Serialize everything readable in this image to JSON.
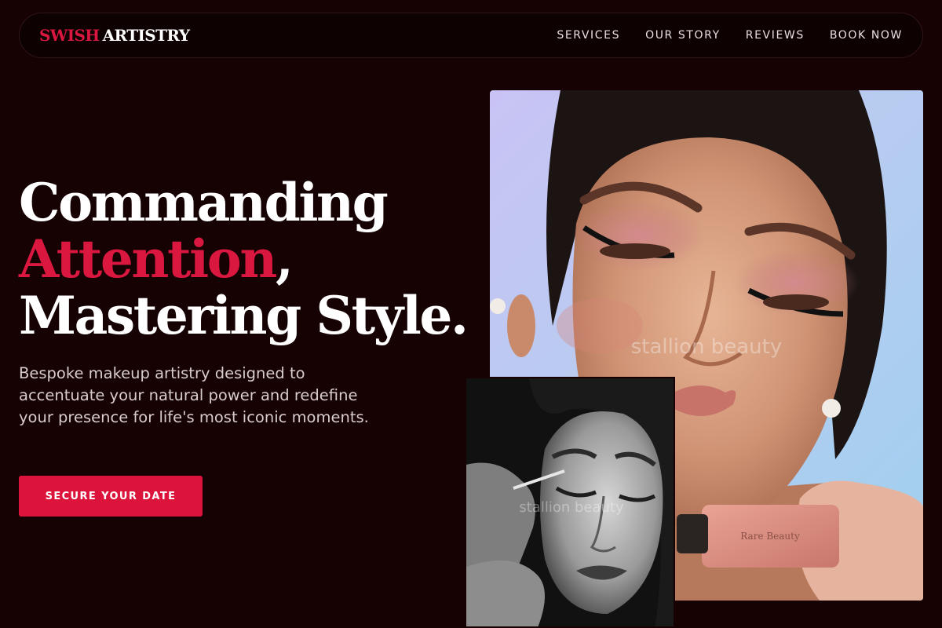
{
  "brand": {
    "part1": "SWISH",
    "part2": "ARTISTRY"
  },
  "nav": {
    "items": [
      {
        "label": "SERVICES"
      },
      {
        "label": "OUR STORY"
      },
      {
        "label": "REVIEWS"
      },
      {
        "label": "BOOK NOW"
      }
    ]
  },
  "hero": {
    "line1": "Commanding",
    "line2_accent": "Attention",
    "line2_punct": ",",
    "line3": "Mastering Style.",
    "subtext": "Bespoke makeup artistry designed to accentuate your natural power and redefine your presence for life's most iconic moments.",
    "cta_label": "SECURE YOUR DATE"
  },
  "images": {
    "main_watermark": "stallion beauty",
    "main_product_label": "Rare Beauty",
    "secondary_watermark": "stallion beauty"
  },
  "colors": {
    "background": "#160103",
    "accent": "#dc143c",
    "text": "#ffffff"
  }
}
